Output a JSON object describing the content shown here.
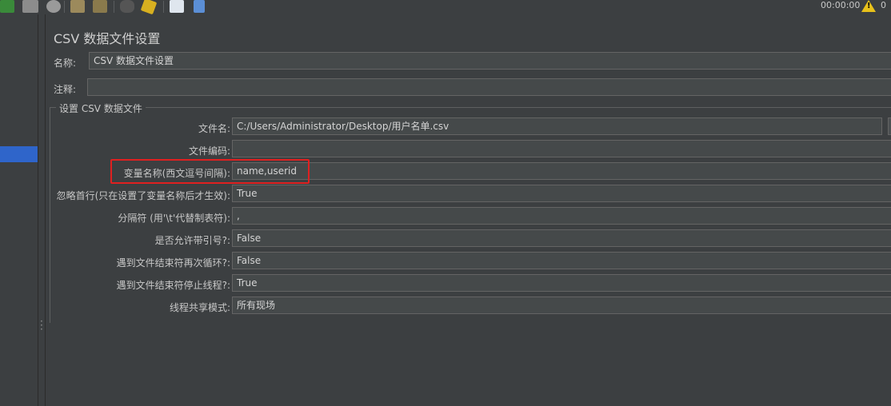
{
  "toolbar": {
    "icons": [
      "run-no-pause-icon",
      "stop-icon",
      "shutdown-icon",
      "clear-icon",
      "clear-all-icon",
      "search-icon",
      "reset-search-icon",
      "function-helper-icon",
      "help-icon"
    ],
    "timer": "00:00:00",
    "warning_count": "0"
  },
  "panel": {
    "title": "CSV 数据文件设置",
    "name_label": "名称:",
    "name_value": "CSV 数据文件设置",
    "comment_label": "注释:",
    "comment_value": "",
    "group_title": "设置 CSV 数据文件",
    "fields": [
      {
        "label": "文件名:",
        "value": "C:/Users/Administrator/Desktop/用户名单.csv"
      },
      {
        "label": "文件编码:",
        "value": ""
      },
      {
        "label": "变量名称(西文逗号间隔):",
        "value": "name,userid"
      },
      {
        "label": "忽略首行(只在设置了变量名称后才生效):",
        "value": "True"
      },
      {
        "label": "分隔符 (用'\\t'代替制表符):",
        "value": ","
      },
      {
        "label": "是否允许带引号?:",
        "value": "False"
      },
      {
        "label": "遇到文件结束符再次循环?:",
        "value": "False"
      },
      {
        "label": "遇到文件结束符停止线程?:",
        "value": "True"
      },
      {
        "label": "线程共享模式:",
        "value": "所有现场"
      }
    ]
  },
  "colors": {
    "background": "#3c3f41",
    "field_bg": "#45494a",
    "selection": "#2f65ca",
    "highlight_box": "#e02020",
    "warning": "#e8c11a"
  }
}
